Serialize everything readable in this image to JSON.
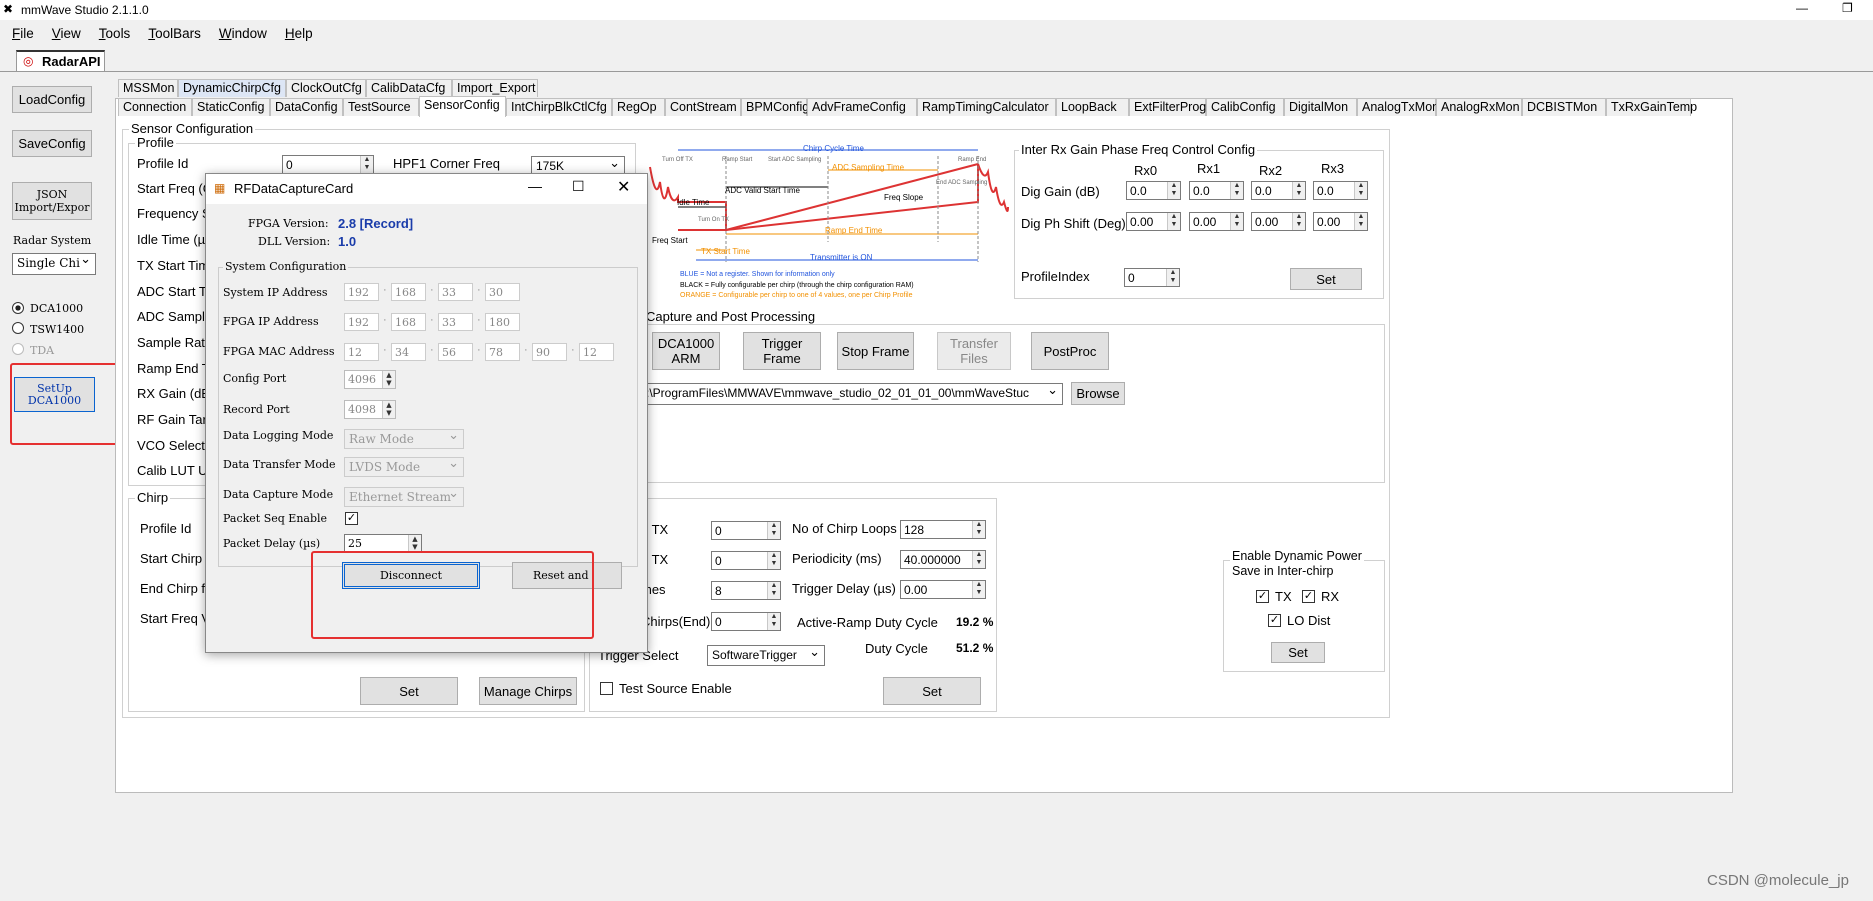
{
  "window": {
    "title": "mmWave Studio 2.1.1.0"
  },
  "menu": [
    "File",
    "View",
    "Tools",
    "ToolBars",
    "Window",
    "Help"
  ],
  "doc_tab": "RadarAPI",
  "left": {
    "load": "LoadConfig",
    "save": "SaveConfig",
    "json": "JSON\nImport/Expor",
    "radar_label": "Radar System",
    "radar_value": "Single Chi",
    "radios": [
      "DCA1000",
      "TSW1400",
      "TDA"
    ],
    "setup": "SetUp\nDCA1000"
  },
  "tabs_row1": [
    "MSSMon",
    "DynamicChirpCfg",
    "ClockOutCfg",
    "CalibDataCfg",
    "Import_Export"
  ],
  "tabs_row2": [
    "Connection",
    "StaticConfig",
    "DataConfig",
    "TestSource",
    "SensorConfig",
    "IntChirpBlkCtlCfg",
    "RegOp",
    "ContStream",
    "BPMConfig",
    "AdvFrameConfig",
    "RampTimingCalculator",
    "LoopBack",
    "ExtFilterProg",
    "CalibConfig",
    "DigitalMon",
    "AnalogTxMon",
    "AnalogRxMon",
    "DCBISTMon",
    "TxRxGainTemp"
  ],
  "sensor": {
    "title": "Sensor Configuration",
    "profile": {
      "title": "Profile",
      "labels": [
        "Profile Id",
        "Start Freq (G",
        "Frequency S",
        "Idle Time (µs",
        "TX Start Tim",
        "ADC Start Ti",
        "ADC Sample",
        "Sample Rate",
        "Ramp End T",
        "RX Gain (dB",
        "RF Gain Targ",
        "VCO Select",
        "Calib LUT U"
      ],
      "profile_id": "0",
      "hpf_label": "HPF1 Corner Freq",
      "hpf_value": "175K"
    },
    "chirp": {
      "title": "Chirp",
      "labels": [
        "Profile Id",
        "Start Chirp f",
        "End Chirp fo",
        "Start Freq Va"
      ],
      "set": "Set",
      "manage": "Manage Chirps"
    }
  },
  "diagram": {
    "chirp_cycle": "Chirp Cycle Time",
    "adc_sampling": "ADC Sampling Time",
    "adc_valid": "ADC Valid Start Time",
    "idle": "Idle Time",
    "freq_slope": "Freq Slope",
    "ramp_end": "Ramp End Time",
    "freq_start": "Freq Start",
    "tx_start": "TX Start Time",
    "transmitter_on": "Transmitter is ON",
    "small": [
      "Turn Off TX",
      "Ramp Start",
      "Start ADC Sampling",
      "Ramp End",
      "End ADC Sampling",
      "Turn On TX"
    ],
    "legend": [
      "BLUE = Not a register. Shown for information only",
      "BLACK = Fully configurable per chirp (through the chirp configuration RAM)",
      "ORANGE = Configurable per chirp to one of 4 values, one per Chirp Profile"
    ]
  },
  "inter_rx": {
    "title": "Inter Rx Gain Phase Freq Control Config",
    "cols": [
      "Rx0",
      "Rx1",
      "Rx2",
      "Rx3"
    ],
    "dig_gain": "Dig Gain (dB)",
    "dig_phase": "Dig Ph Shift (Deg)",
    "gain_vals": [
      "0.0",
      "0.0",
      "0.0",
      "0.0"
    ],
    "phase_vals": [
      "0.00",
      "0.00",
      "0.00",
      "0.00"
    ],
    "profile_index": "ProfileIndex",
    "profile_index_val": "0",
    "set": "Set"
  },
  "capture": {
    "title": "Capture and Post Processing",
    "buttons": [
      "DCA1000\nARM",
      "Trigger\nFrame",
      "Stop Frame",
      "Transfer\nFiles",
      "PostProc"
    ],
    "path": ":\\ProgramFiles\\MMWAVE\\mmwave_studio_02_01_01_00\\mmWaveStuc",
    "browse": "Browse"
  },
  "frame": {
    "l1": "p TX",
    "l2": "p TX",
    "l3": "mes",
    "l4": "Chirps(End)",
    "v1": "0",
    "v2": "0",
    "v3": "8",
    "v4": "0",
    "loops_label": "No of Chirp Loops",
    "loops": "128",
    "period_label": "Periodicity (ms)",
    "period": "40.000000",
    "delay_label": "Trigger Delay (µs)",
    "delay": "0.00",
    "active_label": "Active-Ramp Duty Cycle",
    "active": "19.2 %",
    "duty_label": "Duty Cycle",
    "duty": "51.2 %",
    "trig_label": "Trigger Select",
    "trig": "SoftwareTrigger",
    "test_source": "Test Source Enable",
    "set": "Set"
  },
  "dyn_power": {
    "title": "Enable Dynamic Power\nSave in Inter-chirp",
    "tx": "TX",
    "rx": "RX",
    "lo": "LO Dist",
    "set": "Set"
  },
  "dialog": {
    "title": "RFDataCaptureCard",
    "fpga_label": "FPGA Version:",
    "fpga_val": "2.8 [Record]",
    "dll_label": "DLL Version:",
    "dll_val": "1.0",
    "sys_title": "System Configuration",
    "sys_ip_label": "System IP Address",
    "sys_ip": [
      "192",
      "168",
      "33",
      "30"
    ],
    "fpga_ip_label": "FPGA IP Address",
    "fpga_ip": [
      "192",
      "168",
      "33",
      "180"
    ],
    "mac_label": "FPGA MAC Address",
    "mac": [
      "12",
      "34",
      "56",
      "78",
      "90",
      "12"
    ],
    "config_port_label": "Config Port",
    "config_port": "4096",
    "record_port_label": "Record Port",
    "record_port": "4098",
    "log_label": "Data Logging Mode",
    "log": "Raw Mode",
    "transfer_label": "Data Transfer Mode",
    "transfer": "LVDS Mode",
    "capture_label": "Data Capture Mode",
    "capture": "Ethernet Stream",
    "seq_label": "Packet Seq Enable",
    "delay_label": "Packet Delay (µs)",
    "delay": "25",
    "disconnect": "Disconnect",
    "reset": "Reset and"
  },
  "watermark": "CSDN @molecule_jp"
}
